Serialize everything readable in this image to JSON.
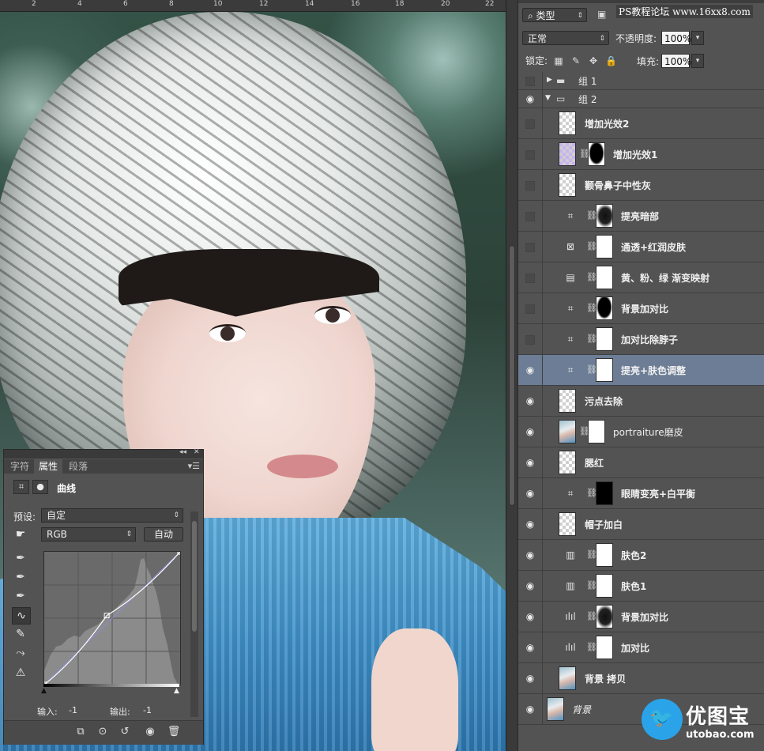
{
  "ruler": {
    "ticks": [
      "2",
      "4",
      "6",
      "8",
      "10",
      "12",
      "14",
      "16",
      "18",
      "20",
      "22"
    ]
  },
  "layers_panel": {
    "filter_kind": "类型",
    "watermark": "PS教程论坛 www.16xx8.com",
    "blend_mode": "正常",
    "opacity_label": "不透明度:",
    "opacity_value": "100%",
    "lock_label": "锁定:",
    "fill_label": "填充:",
    "fill_value": "100%",
    "groups": [
      {
        "name": "组 1",
        "expanded": false,
        "visible": false
      },
      {
        "name": "组 2",
        "expanded": true,
        "visible": true
      }
    ],
    "layers": [
      {
        "name": "增加光效2",
        "visible": false,
        "kind": "pixel",
        "selected": false
      },
      {
        "name": "增加光效1",
        "visible": false,
        "kind": "pixel-mask",
        "selected": false
      },
      {
        "name": "颧骨鼻子中性灰",
        "visible": false,
        "kind": "pixel",
        "selected": false
      },
      {
        "name": "提亮暗部",
        "visible": false,
        "kind": "curves",
        "selected": false
      },
      {
        "name": "通透+红润皮肤",
        "visible": false,
        "kind": "channel-mixer",
        "selected": false
      },
      {
        "name": "黄、粉、绿 渐变映射",
        "visible": false,
        "kind": "gradient-map",
        "selected": false
      },
      {
        "name": "背景加对比",
        "visible": false,
        "kind": "curves",
        "selected": false
      },
      {
        "name": "加对比除脖子",
        "visible": false,
        "kind": "curves",
        "selected": false
      },
      {
        "name": "提亮+肤色调整",
        "visible": true,
        "kind": "curves",
        "selected": true
      },
      {
        "name": "污点去除",
        "visible": true,
        "kind": "pixel",
        "selected": false
      },
      {
        "name": "portraiture磨皮",
        "visible": true,
        "kind": "photo-mask",
        "selected": false
      },
      {
        "name": "腮红",
        "visible": true,
        "kind": "pixel",
        "selected": false
      },
      {
        "name": "眼睛变亮+白平衡",
        "visible": true,
        "kind": "curves",
        "selected": false
      },
      {
        "name": "帽子加白",
        "visible": true,
        "kind": "pixel",
        "selected": false
      },
      {
        "name": "肤色2",
        "visible": true,
        "kind": "selective-color",
        "selected": false
      },
      {
        "name": "肤色1",
        "visible": true,
        "kind": "selective-color",
        "selected": false
      },
      {
        "name": "背景加对比",
        "visible": true,
        "kind": "levels",
        "selected": false
      },
      {
        "name": "加对比",
        "visible": true,
        "kind": "levels",
        "selected": false
      },
      {
        "name": "背景 拷贝",
        "visible": true,
        "kind": "photo",
        "selected": false
      },
      {
        "name": "背景",
        "visible": true,
        "kind": "photo",
        "selected": false
      }
    ]
  },
  "logo": {
    "cn": "优图宝",
    "en": "utobao.com"
  },
  "properties_panel": {
    "tabs": [
      "字符",
      "属性",
      "段落"
    ],
    "active_tab": "属性",
    "adjustment_title": "曲线",
    "preset_label": "预设:",
    "preset_value": "自定",
    "channel_value": "RGB",
    "auto_button": "自动",
    "input_label": "输入:",
    "input_value": "-1",
    "output_label": "输出:",
    "output_value": "-1",
    "curve_points": [
      [
        0,
        0
      ],
      [
        0.46,
        0.52
      ],
      [
        1,
        1
      ]
    ]
  }
}
